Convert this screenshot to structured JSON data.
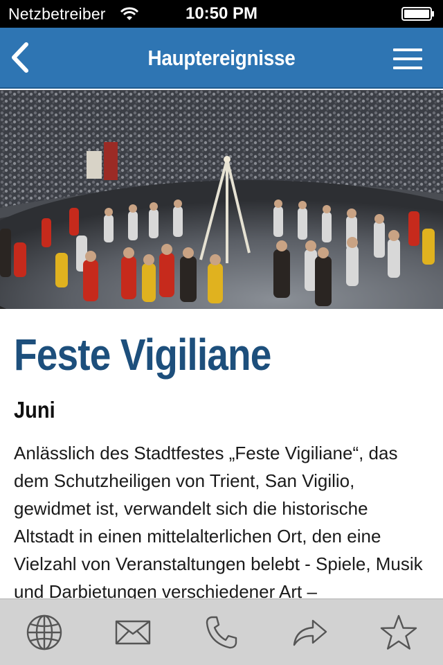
{
  "status_bar": {
    "carrier": "Netzbetreiber",
    "time": "10:50 PM"
  },
  "nav": {
    "title": "Hauptereignisse",
    "back_icon": "chevron-left-icon",
    "menu_icon": "hamburger-menu-icon"
  },
  "article": {
    "title": "Feste Vigiliane",
    "date": "Juni",
    "body": "Anlässlich des Stadtfestes „Feste Vigiliane“, das dem Schutzheiligen von Trient, San Vigilio, gewidmet ist, verwandelt sich die historische Altstadt in einen mittelalterlichen Ort, den eine Vielzahl von Veranstaltungen belebt - Spiele, Musik und Darbietungen verschiedener Art –"
  },
  "tabbar": {
    "items": [
      "globe-icon",
      "mail-icon",
      "phone-icon",
      "share-icon",
      "star-icon"
    ]
  },
  "colors": {
    "nav_bg": "#2e75b3",
    "title_text": "#1d4f7c",
    "tabbar_bg": "#d2d2d2"
  }
}
